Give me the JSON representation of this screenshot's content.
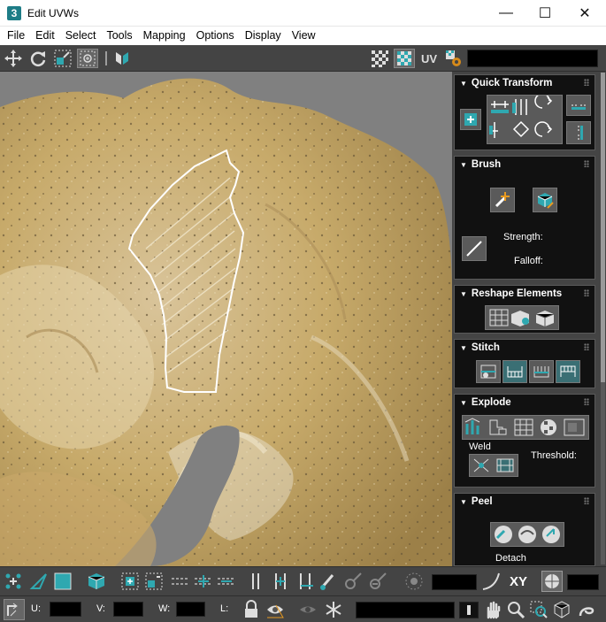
{
  "window": {
    "app_icon_label": "3",
    "title": "Edit UVWs",
    "minimize_glyph": "—",
    "maximize_glyph": "☐",
    "close_glyph": "✕"
  },
  "menu": [
    "File",
    "Edit",
    "Select",
    "Tools",
    "Mapping",
    "Options",
    "Display",
    "View"
  ],
  "toolbar": {
    "uv_label": "UV",
    "icons": [
      "move-icon",
      "rotate-icon",
      "scale-icon",
      "freeform-icon",
      "mirror-icon",
      "checker-icon",
      "checker-teal-icon",
      "settings-gear-icon"
    ]
  },
  "panel": {
    "quick_transform": {
      "title": "Quick Transform"
    },
    "brush": {
      "title": "Brush",
      "strength_label": "Strength:",
      "falloff_label": "Falloff:"
    },
    "reshape": {
      "title": "Reshape Elements"
    },
    "stitch": {
      "title": "Stitch"
    },
    "explode": {
      "title": "Explode",
      "weld_label": "Weld",
      "threshold_label": "Threshold:"
    },
    "peel": {
      "title": "Peel",
      "detach_label": "Detach"
    }
  },
  "bottom": {
    "xy_label": "XY",
    "u_label": "U:",
    "v_label": "V:",
    "w_label": "W:",
    "l_label": "L:"
  },
  "colors": {
    "accent_teal": "#2fa8b0",
    "panel_bg": "#444444",
    "rollout_bg": "#111111",
    "uv_outline": "#ffffff"
  }
}
